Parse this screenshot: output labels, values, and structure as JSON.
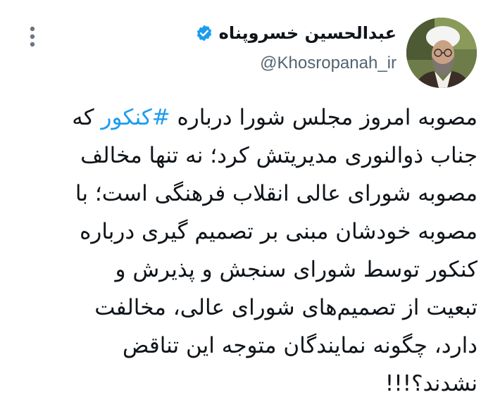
{
  "author": {
    "display_name": "عبدالحسین خسروپناه",
    "handle": "@Khosropanah_ir",
    "verified": true,
    "verified_color": "#1d9bf0"
  },
  "icons": {
    "more": "more-vertical-icon",
    "verified": "verified-badge-icon",
    "avatar": "profile-photo"
  },
  "tweet": {
    "hashtag": "#کنکور",
    "hashtag_color": "#1d9bf0",
    "line1_before": "مصوبه امروز مجلس شورا درباره ",
    "line1_after": " که",
    "lines": [
      "جناب ذوالنوری مدیریتش کرد؛ نه تنها مخالف",
      "مصوبه شورای عالی انقلاب فرهنگی است؛ با",
      "مصوبه خودشان مبنی بر تصمیم گیری درباره",
      "کنکور توسط شورای سنجش و پذیرش و",
      "تبعیت از تصمیم‌های شورای عالی، مخالفت",
      "دارد، چگونه نمایندگان متوجه این تناقض",
      "نشدند؟!!!"
    ]
  }
}
